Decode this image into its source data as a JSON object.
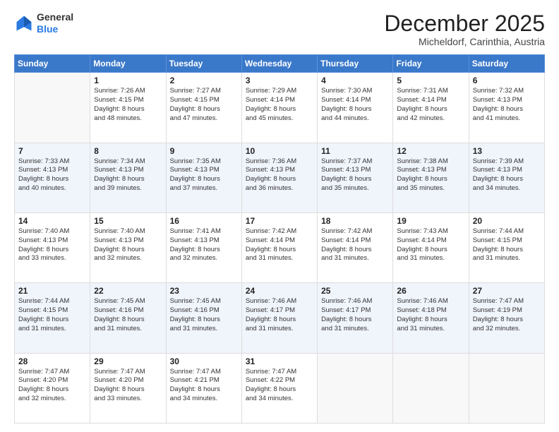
{
  "logo": {
    "general": "General",
    "blue": "Blue"
  },
  "header": {
    "month": "December 2025",
    "location": "Micheldorf, Carinthia, Austria"
  },
  "weekdays": [
    "Sunday",
    "Monday",
    "Tuesday",
    "Wednesday",
    "Thursday",
    "Friday",
    "Saturday"
  ],
  "weeks": [
    [
      {
        "day": "",
        "sunrise": "",
        "sunset": "",
        "daylight": ""
      },
      {
        "day": "1",
        "sunrise": "Sunrise: 7:26 AM",
        "sunset": "Sunset: 4:15 PM",
        "daylight": "Daylight: 8 hours and 48 minutes."
      },
      {
        "day": "2",
        "sunrise": "Sunrise: 7:27 AM",
        "sunset": "Sunset: 4:15 PM",
        "daylight": "Daylight: 8 hours and 47 minutes."
      },
      {
        "day": "3",
        "sunrise": "Sunrise: 7:29 AM",
        "sunset": "Sunset: 4:14 PM",
        "daylight": "Daylight: 8 hours and 45 minutes."
      },
      {
        "day": "4",
        "sunrise": "Sunrise: 7:30 AM",
        "sunset": "Sunset: 4:14 PM",
        "daylight": "Daylight: 8 hours and 44 minutes."
      },
      {
        "day": "5",
        "sunrise": "Sunrise: 7:31 AM",
        "sunset": "Sunset: 4:14 PM",
        "daylight": "Daylight: 8 hours and 42 minutes."
      },
      {
        "day": "6",
        "sunrise": "Sunrise: 7:32 AM",
        "sunset": "Sunset: 4:13 PM",
        "daylight": "Daylight: 8 hours and 41 minutes."
      }
    ],
    [
      {
        "day": "7",
        "sunrise": "Sunrise: 7:33 AM",
        "sunset": "Sunset: 4:13 PM",
        "daylight": "Daylight: 8 hours and 40 minutes."
      },
      {
        "day": "8",
        "sunrise": "Sunrise: 7:34 AM",
        "sunset": "Sunset: 4:13 PM",
        "daylight": "Daylight: 8 hours and 39 minutes."
      },
      {
        "day": "9",
        "sunrise": "Sunrise: 7:35 AM",
        "sunset": "Sunset: 4:13 PM",
        "daylight": "Daylight: 8 hours and 37 minutes."
      },
      {
        "day": "10",
        "sunrise": "Sunrise: 7:36 AM",
        "sunset": "Sunset: 4:13 PM",
        "daylight": "Daylight: 8 hours and 36 minutes."
      },
      {
        "day": "11",
        "sunrise": "Sunrise: 7:37 AM",
        "sunset": "Sunset: 4:13 PM",
        "daylight": "Daylight: 8 hours and 35 minutes."
      },
      {
        "day": "12",
        "sunrise": "Sunrise: 7:38 AM",
        "sunset": "Sunset: 4:13 PM",
        "daylight": "Daylight: 8 hours and 35 minutes."
      },
      {
        "day": "13",
        "sunrise": "Sunrise: 7:39 AM",
        "sunset": "Sunset: 4:13 PM",
        "daylight": "Daylight: 8 hours and 34 minutes."
      }
    ],
    [
      {
        "day": "14",
        "sunrise": "Sunrise: 7:40 AM",
        "sunset": "Sunset: 4:13 PM",
        "daylight": "Daylight: 8 hours and 33 minutes."
      },
      {
        "day": "15",
        "sunrise": "Sunrise: 7:40 AM",
        "sunset": "Sunset: 4:13 PM",
        "daylight": "Daylight: 8 hours and 32 minutes."
      },
      {
        "day": "16",
        "sunrise": "Sunrise: 7:41 AM",
        "sunset": "Sunset: 4:13 PM",
        "daylight": "Daylight: 8 hours and 32 minutes."
      },
      {
        "day": "17",
        "sunrise": "Sunrise: 7:42 AM",
        "sunset": "Sunset: 4:14 PM",
        "daylight": "Daylight: 8 hours and 31 minutes."
      },
      {
        "day": "18",
        "sunrise": "Sunrise: 7:42 AM",
        "sunset": "Sunset: 4:14 PM",
        "daylight": "Daylight: 8 hours and 31 minutes."
      },
      {
        "day": "19",
        "sunrise": "Sunrise: 7:43 AM",
        "sunset": "Sunset: 4:14 PM",
        "daylight": "Daylight: 8 hours and 31 minutes."
      },
      {
        "day": "20",
        "sunrise": "Sunrise: 7:44 AM",
        "sunset": "Sunset: 4:15 PM",
        "daylight": "Daylight: 8 hours and 31 minutes."
      }
    ],
    [
      {
        "day": "21",
        "sunrise": "Sunrise: 7:44 AM",
        "sunset": "Sunset: 4:15 PM",
        "daylight": "Daylight: 8 hours and 31 minutes."
      },
      {
        "day": "22",
        "sunrise": "Sunrise: 7:45 AM",
        "sunset": "Sunset: 4:16 PM",
        "daylight": "Daylight: 8 hours and 31 minutes."
      },
      {
        "day": "23",
        "sunrise": "Sunrise: 7:45 AM",
        "sunset": "Sunset: 4:16 PM",
        "daylight": "Daylight: 8 hours and 31 minutes."
      },
      {
        "day": "24",
        "sunrise": "Sunrise: 7:46 AM",
        "sunset": "Sunset: 4:17 PM",
        "daylight": "Daylight: 8 hours and 31 minutes."
      },
      {
        "day": "25",
        "sunrise": "Sunrise: 7:46 AM",
        "sunset": "Sunset: 4:17 PM",
        "daylight": "Daylight: 8 hours and 31 minutes."
      },
      {
        "day": "26",
        "sunrise": "Sunrise: 7:46 AM",
        "sunset": "Sunset: 4:18 PM",
        "daylight": "Daylight: 8 hours and 31 minutes."
      },
      {
        "day": "27",
        "sunrise": "Sunrise: 7:47 AM",
        "sunset": "Sunset: 4:19 PM",
        "daylight": "Daylight: 8 hours and 32 minutes."
      }
    ],
    [
      {
        "day": "28",
        "sunrise": "Sunrise: 7:47 AM",
        "sunset": "Sunset: 4:20 PM",
        "daylight": "Daylight: 8 hours and 32 minutes."
      },
      {
        "day": "29",
        "sunrise": "Sunrise: 7:47 AM",
        "sunset": "Sunset: 4:20 PM",
        "daylight": "Daylight: 8 hours and 33 minutes."
      },
      {
        "day": "30",
        "sunrise": "Sunrise: 7:47 AM",
        "sunset": "Sunset: 4:21 PM",
        "daylight": "Daylight: 8 hours and 34 minutes."
      },
      {
        "day": "31",
        "sunrise": "Sunrise: 7:47 AM",
        "sunset": "Sunset: 4:22 PM",
        "daylight": "Daylight: 8 hours and 34 minutes."
      },
      {
        "day": "",
        "sunrise": "",
        "sunset": "",
        "daylight": ""
      },
      {
        "day": "",
        "sunrise": "",
        "sunset": "",
        "daylight": ""
      },
      {
        "day": "",
        "sunrise": "",
        "sunset": "",
        "daylight": ""
      }
    ]
  ]
}
